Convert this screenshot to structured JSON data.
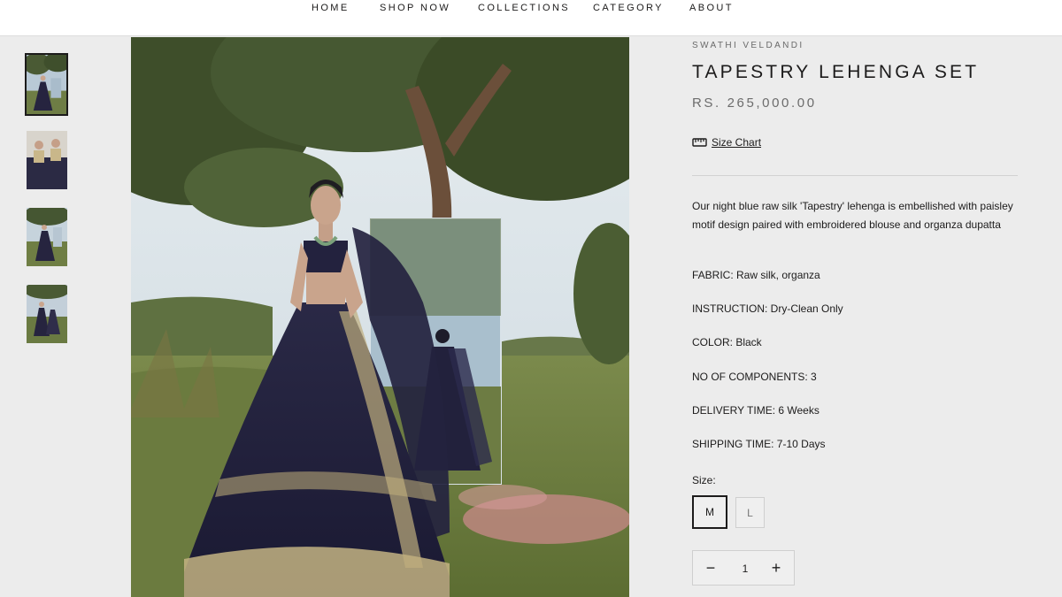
{
  "nav": {
    "items": [
      "HOME",
      "SHOP NOW",
      "COLLECTIONS",
      "CATEGORY",
      "ABOUT"
    ]
  },
  "product": {
    "vendor": "SWATHI VELDANDI",
    "title": "TAPESTRY LEHENGA SET",
    "price": "RS. 265,000.00",
    "size_chart_label": "Size Chart",
    "description": "Our night blue raw silk 'Tapestry' lehenga is embellished with paisley motif design paired with embroidered blouse and organza dupatta",
    "specs": [
      "FABRIC: Raw silk, organza",
      "INSTRUCTION: Dry-Clean Only",
      "COLOR: Black",
      "NO OF COMPONENTS: 3",
      "DELIVERY TIME: 6 Weeks",
      "SHIPPING TIME: 7-10 Days"
    ],
    "size_label": "Size:",
    "sizes": [
      "M",
      "L"
    ],
    "selected_size": "M",
    "quantity": "1",
    "minus_symbol": "−",
    "plus_symbol": "+"
  },
  "colors": {
    "text": "#1c1b1b",
    "muted": "#6c6c6c",
    "background": "#ececec",
    "lehenga": "#1f1e3a",
    "gold": "#c8b98a"
  }
}
